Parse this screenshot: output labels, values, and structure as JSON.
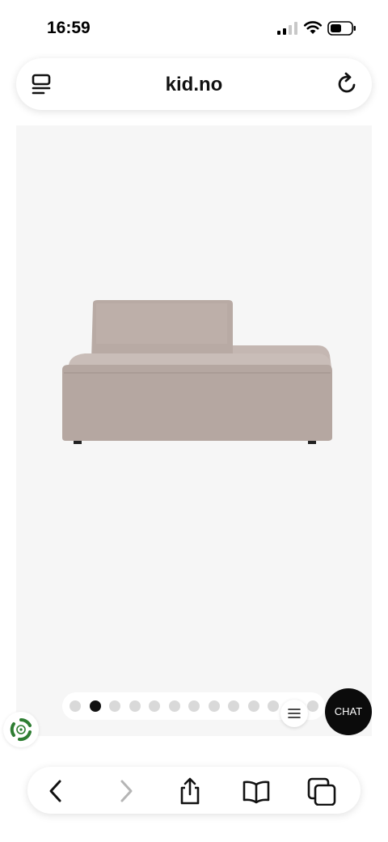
{
  "status_bar": {
    "time": "16:59"
  },
  "browser": {
    "url": "kid.no"
  },
  "gallery": {
    "image_count": 13,
    "active_index": 1,
    "product_image": "beige modular chaise sofa"
  },
  "chat": {
    "label": "CHAT"
  },
  "icons": {
    "tab": "tab-overview-icon",
    "reload": "reload-icon",
    "menu": "hamburger-menu-icon",
    "recycle": "recycle-icon",
    "back": "chevron-left-icon",
    "forward": "chevron-right-icon",
    "share": "share-icon",
    "bookmarks": "book-icon",
    "tabs": "tabs-icon"
  },
  "colors": {
    "gallery_bg": "#f6f6f6",
    "dot_active": "#111111",
    "dot_inactive": "#d9d9d9",
    "chat_bg": "#0b0b0b",
    "recycle_green": "#2e7d32"
  }
}
